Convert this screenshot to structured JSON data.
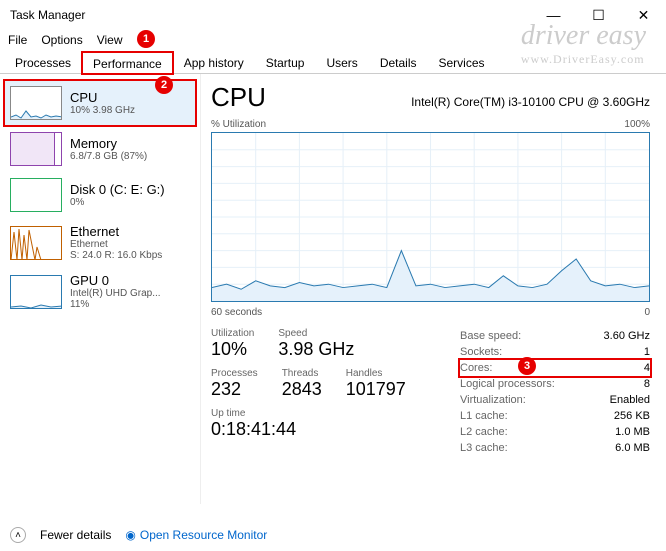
{
  "window": {
    "title": "Task Manager"
  },
  "menu": {
    "file": "File",
    "options": "Options",
    "view": "View"
  },
  "tabs": {
    "processes": "Processes",
    "performance": "Performance",
    "apphistory": "App history",
    "startup": "Startup",
    "users": "Users",
    "details": "Details",
    "services": "Services"
  },
  "sidebar": {
    "cpu": {
      "title": "CPU",
      "sub": "10% 3.98 GHz"
    },
    "memory": {
      "title": "Memory",
      "sub": "6.8/7.8 GB (87%)"
    },
    "disk": {
      "title": "Disk 0 (C: E: G:)",
      "sub": "0%"
    },
    "eth": {
      "title": "Ethernet",
      "sub": "Ethernet",
      "sub2": "S: 24.0 R: 16.0 Kbps"
    },
    "gpu": {
      "title": "GPU 0",
      "sub": "Intel(R) UHD Grap...",
      "sub2": "11%"
    }
  },
  "main": {
    "heading": "CPU",
    "model": "Intel(R) Core(TM) i3-10100 CPU @ 3.60GHz",
    "chart_top_left": "% Utilization",
    "chart_top_right": "100%",
    "chart_bot_left": "60 seconds",
    "chart_bot_right": "0",
    "stats": {
      "util_l": "Utilization",
      "util": "10%",
      "speed_l": "Speed",
      "speed": "3.98 GHz",
      "proc_l": "Processes",
      "proc": "232",
      "thr_l": "Threads",
      "thr": "2843",
      "hnd_l": "Handles",
      "hnd": "101797",
      "up_l": "Up time",
      "up": "0:18:41:44"
    },
    "right": {
      "base_l": "Base speed:",
      "base": "3.60 GHz",
      "sock_l": "Sockets:",
      "sock": "1",
      "cores_l": "Cores:",
      "cores": "4",
      "lp_l": "Logical processors:",
      "lp": "8",
      "virt_l": "Virtualization:",
      "virt": "Enabled",
      "l1_l": "L1 cache:",
      "l1": "256 KB",
      "l2_l": "L2 cache:",
      "l2": "1.0 MB",
      "l3_l": "L3 cache:",
      "l3": "6.0 MB"
    }
  },
  "footer": {
    "fewer": "Fewer details",
    "orm": "Open Resource Monitor"
  },
  "annotations": {
    "a1": "1",
    "a2": "2",
    "a3": "3"
  },
  "chart_data": {
    "type": "line",
    "title": "% Utilization",
    "xlabel": "60 seconds",
    "ylabel": "% Utilization",
    "ylim": [
      0,
      100
    ],
    "x": [
      0,
      2,
      4,
      6,
      8,
      10,
      12,
      14,
      16,
      18,
      20,
      22,
      24,
      26,
      28,
      30,
      32,
      34,
      36,
      38,
      40,
      42,
      44,
      46,
      48,
      50,
      52,
      54,
      56,
      58,
      60
    ],
    "values": [
      8,
      10,
      7,
      12,
      9,
      8,
      11,
      9,
      10,
      8,
      9,
      10,
      8,
      30,
      9,
      10,
      8,
      9,
      10,
      8,
      15,
      9,
      8,
      10,
      18,
      25,
      12,
      9,
      10,
      8,
      9
    ]
  }
}
